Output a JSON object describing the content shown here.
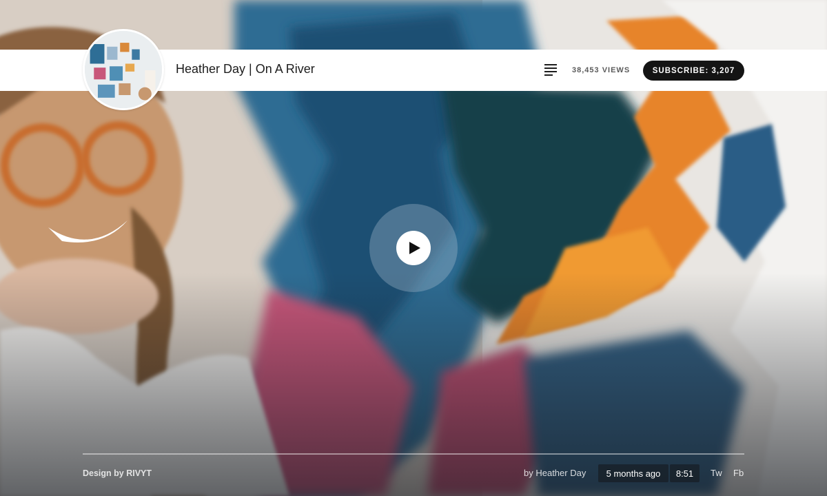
{
  "header": {
    "video_title": "Heather Day | On A River",
    "views": "38,453 VIEWS",
    "subscribe_label": "SUBSCRIBE: 3,207",
    "menu_icon": "list-icon"
  },
  "player": {
    "play_icon": "play-icon"
  },
  "footer": {
    "credit": "Design by RIVYT",
    "byline": "by Heather Day",
    "posted": "5 months ago",
    "duration": "8:51",
    "share_twitter": "Tw",
    "share_facebook": "Fb"
  },
  "colors": {
    "subscribe_bg": "#141414",
    "topbar_bg": "#ffffff"
  }
}
